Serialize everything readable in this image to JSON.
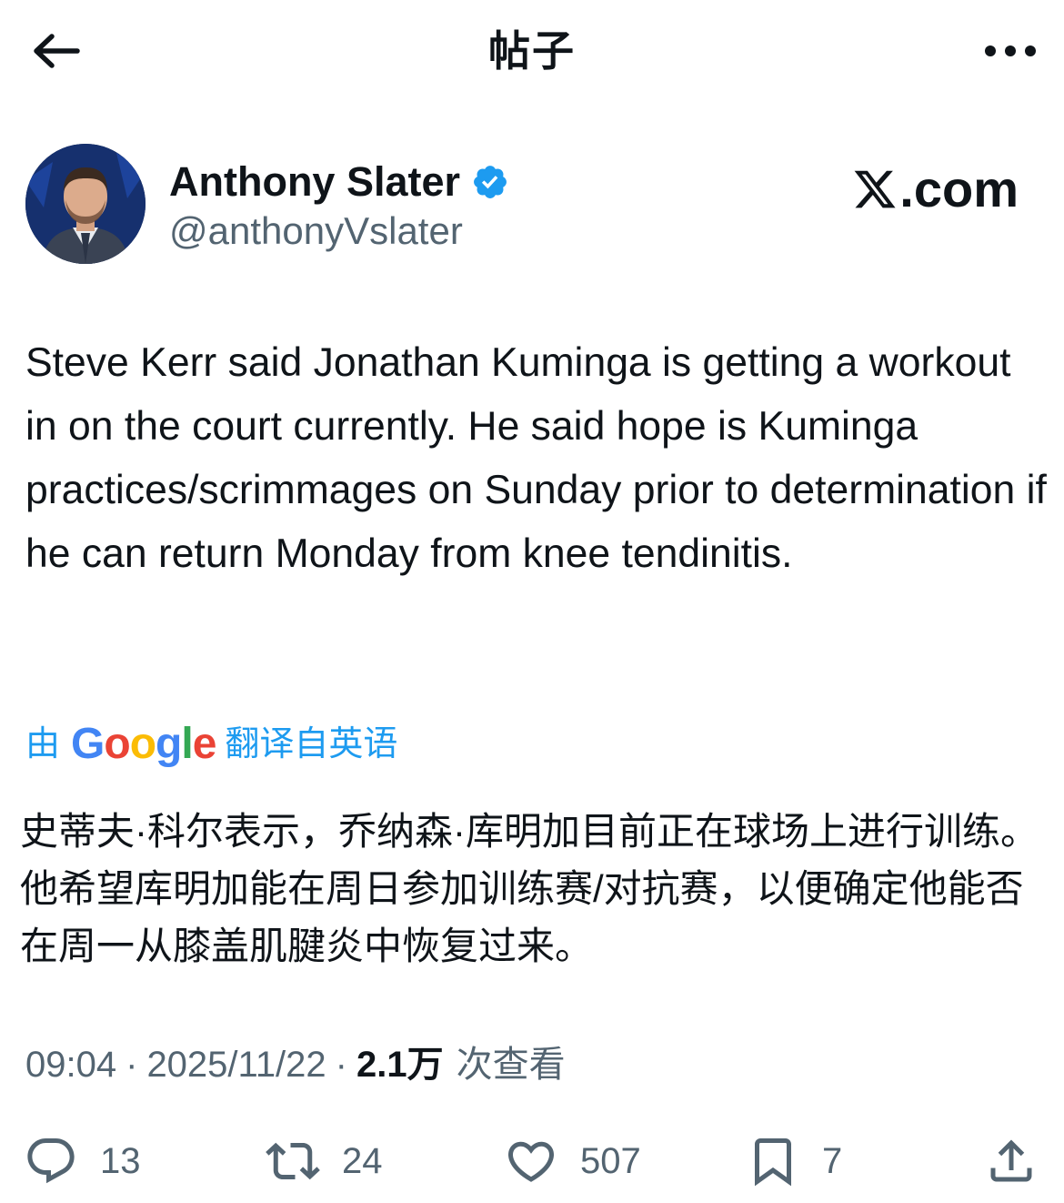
{
  "header": {
    "title": "帖子",
    "back_icon": "arrow-left-icon",
    "more_icon": "more-horizontal-icon"
  },
  "author": {
    "display_name": "Anthony Slater",
    "handle": "@anthonyVslater",
    "verified": true,
    "verified_color": "#1d9bf0"
  },
  "watermark": {
    "text": ".com"
  },
  "tweet": {
    "text": "Steve Kerr said Jonathan Kuminga is getting a workout in on the court currently. He said hope is Kuminga practices/scrimmages on Sunday prior to determination if he can return Monday from knee tendinitis."
  },
  "translation": {
    "prefix": "由",
    "brand": "Google",
    "suffix": "翻译自英语",
    "text": "史蒂夫·科尔表示，乔纳森·库明加目前正在球场上进行训练。他希望库明加能在周日参加训练赛/对抗赛，以便确定他能否在周一从膝盖肌腱炎中恢复过来。",
    "link_color": "#1d9bf0"
  },
  "meta": {
    "time": "09:04",
    "separator": "·",
    "date": "2025/11/22",
    "views": "2.1万",
    "views_label": "次查看"
  },
  "actions": {
    "reply_count": "13",
    "repost_count": "24",
    "like_count": "507",
    "bookmark_count": "7"
  },
  "colors": {
    "text": "#0f1419",
    "secondary": "#536471",
    "accent": "#1d9bf0"
  }
}
